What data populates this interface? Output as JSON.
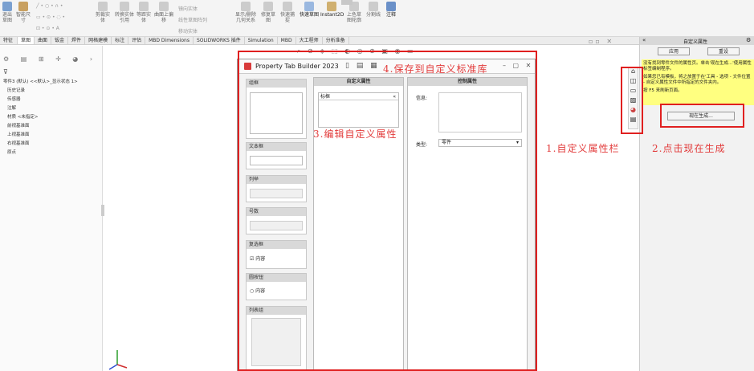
{
  "ribbon": {
    "buttons": [
      "退出草图",
      "智能尺寸",
      "剪裁实体",
      "转换实体引用",
      "等距实体",
      "曲面上偏移",
      "镜向实体",
      "线性草图阵列",
      "移动实体",
      "显示/删除几何关系",
      "修复草图",
      "快速捕捉",
      "快速草图",
      "Instant2D",
      "上色草图轮廓",
      "分割线",
      "注释"
    ]
  },
  "tabs": [
    "特征",
    "草图",
    "曲面",
    "钣金",
    "焊件",
    "网格建模",
    "标注",
    "评估",
    "MBD Dimensions",
    "SOLIDWORKS 插件",
    "Simulation",
    "MBD",
    "大工程师",
    "分析准备"
  ],
  "feature_tree": {
    "root": "零件3 (默认) <<默认>_显示状态 1>",
    "items": [
      "历史记录",
      "传感器",
      "注解",
      "材质 <未指定>",
      "前视基准面",
      "上视基准面",
      "右视基准面",
      "原点"
    ]
  },
  "pti": {
    "title": "Property Tab Builder 2023",
    "controls": {
      "group": "组框",
      "textbox": "文本框",
      "list": "列举",
      "number": "号数",
      "checkbox": "复选框",
      "checkbox_item": "内容",
      "radio": "圆按钮",
      "radio_item": "内容",
      "listgroup": "列表组"
    },
    "custom_panel": {
      "header": "自定义属性",
      "item": "标框"
    },
    "control_panel": {
      "header": "控制属性",
      "label_label": "信息:",
      "type_label": "类型:",
      "type_value": "零件"
    }
  },
  "task_pane": {
    "title": "自定义属性",
    "apply": "应用",
    "reset": "重设",
    "message1": "没有找到零件文件的属性页。单击'现在生成...'使用属性标签编制程序。",
    "message2": "如果您已有模板，将之放置于在'工具 - 选项 - 文件位置 - 自定义属性文件中所指定的文件夹内。",
    "message3": "按 F5 来刷新页面。",
    "generate": "现在生成..."
  },
  "annotations": {
    "a1": "1.自定义属性栏",
    "a2": "2.点击现在生成",
    "a3": "3.编辑自定义属性",
    "a4": "4.保存到自定义标准库"
  },
  "colors": {
    "annotation": "#e23b3b",
    "highlight": "#ffff80",
    "box": "#e02020"
  }
}
